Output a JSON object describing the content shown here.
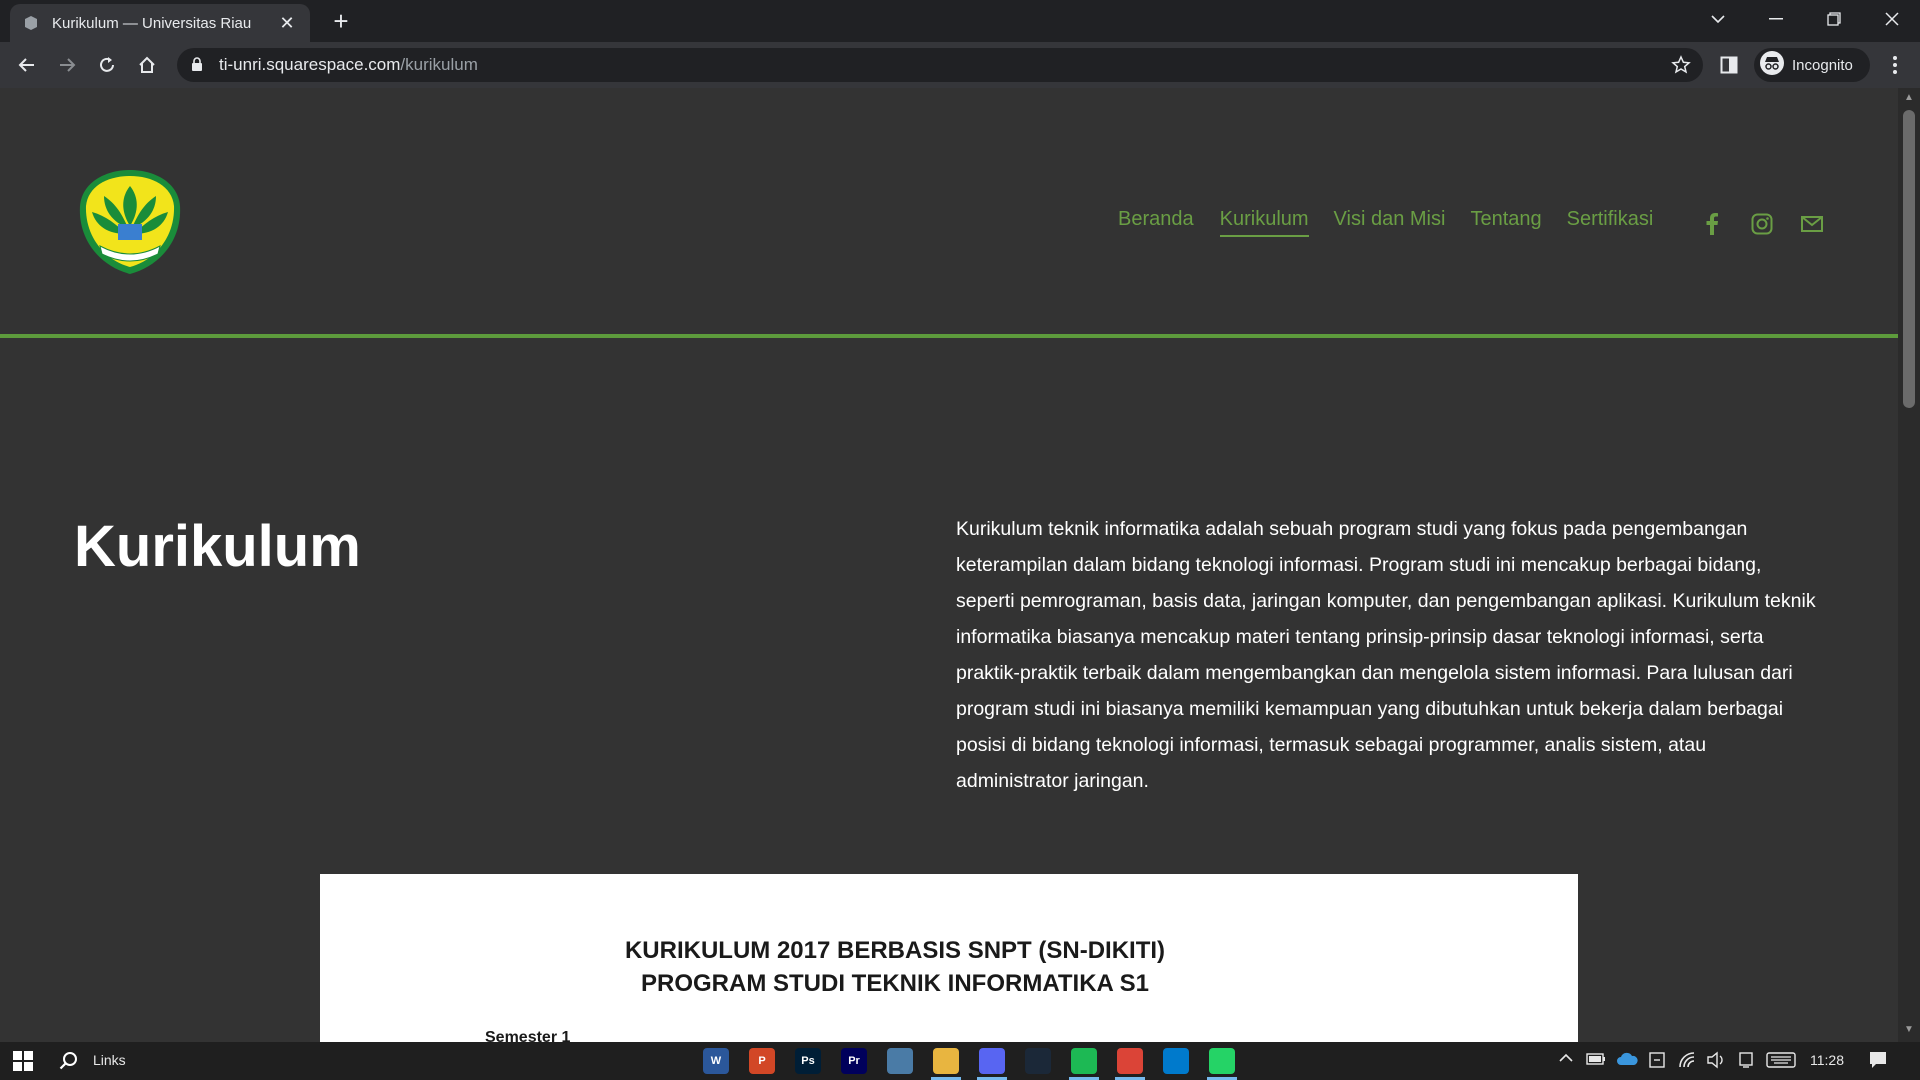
{
  "browser": {
    "tab_title": "Kurikulum — Universitas Riau",
    "url_host": "ti-unri.squarespace.com",
    "url_path": "/kurikulum",
    "profile_label": "Incognito"
  },
  "site": {
    "nav": [
      "Beranda",
      "Kurikulum",
      "Visi dan Misi",
      "Tentang",
      "Sertifikasi"
    ],
    "active_nav": "Kurikulum",
    "logo_text": "UNIVERSITAS RIAU"
  },
  "content": {
    "heading": "Kurikulum",
    "intro": "Kurikulum teknik informatika adalah sebuah program studi yang fokus pada pengembangan keterampilan dalam bidang teknologi informasi. Program studi ini mencakup berbagai bidang, seperti pemrograman, basis data, jaringan komputer, dan pengembangan aplikasi. Kurikulum teknik informatika biasanya mencakup materi tentang prinsip-prinsip dasar teknologi informasi, serta praktik-praktik terbaik dalam mengembangkan dan mengelola sistem informasi. Para lulusan dari program studi ini biasanya memiliki kemampuan yang dibutuhkan untuk bekerja dalam berbagai posisi di bidang teknologi informasi, termasuk sebagai programmer, analis sistem, atau administrator jaringan.",
    "doc_title_line1": "KURIKULUM 2017 BERBASIS SNPT (SN-DIKITI)",
    "doc_title_line2": "PROGRAM STUDI TEKNIK INFORMATIKA S1",
    "doc_semester": "Semester 1"
  },
  "taskbar": {
    "search_label": "Links",
    "apps": [
      {
        "name": "word",
        "label": "W",
        "color": "#2b579a"
      },
      {
        "name": "powerpoint",
        "label": "P",
        "color": "#d24726"
      },
      {
        "name": "photoshop",
        "label": "Ps",
        "color": "#001e36"
      },
      {
        "name": "premiere",
        "label": "Pr",
        "color": "#00005b"
      },
      {
        "name": "photos",
        "label": "",
        "color": "#4a7ba6"
      },
      {
        "name": "file-explorer",
        "label": "",
        "color": "#e8b540"
      },
      {
        "name": "discord",
        "label": "",
        "color": "#5865f2"
      },
      {
        "name": "steam",
        "label": "",
        "color": "#1b2838"
      },
      {
        "name": "spotify",
        "label": "",
        "color": "#1db954"
      },
      {
        "name": "chrome",
        "label": "",
        "color": "#db4437"
      },
      {
        "name": "vscode",
        "label": "",
        "color": "#007acc"
      },
      {
        "name": "whatsapp",
        "label": "",
        "color": "#25d366"
      }
    ],
    "clock": "11:28"
  },
  "colors": {
    "accent_green": "#6a9e44",
    "page_bg": "#333333"
  }
}
